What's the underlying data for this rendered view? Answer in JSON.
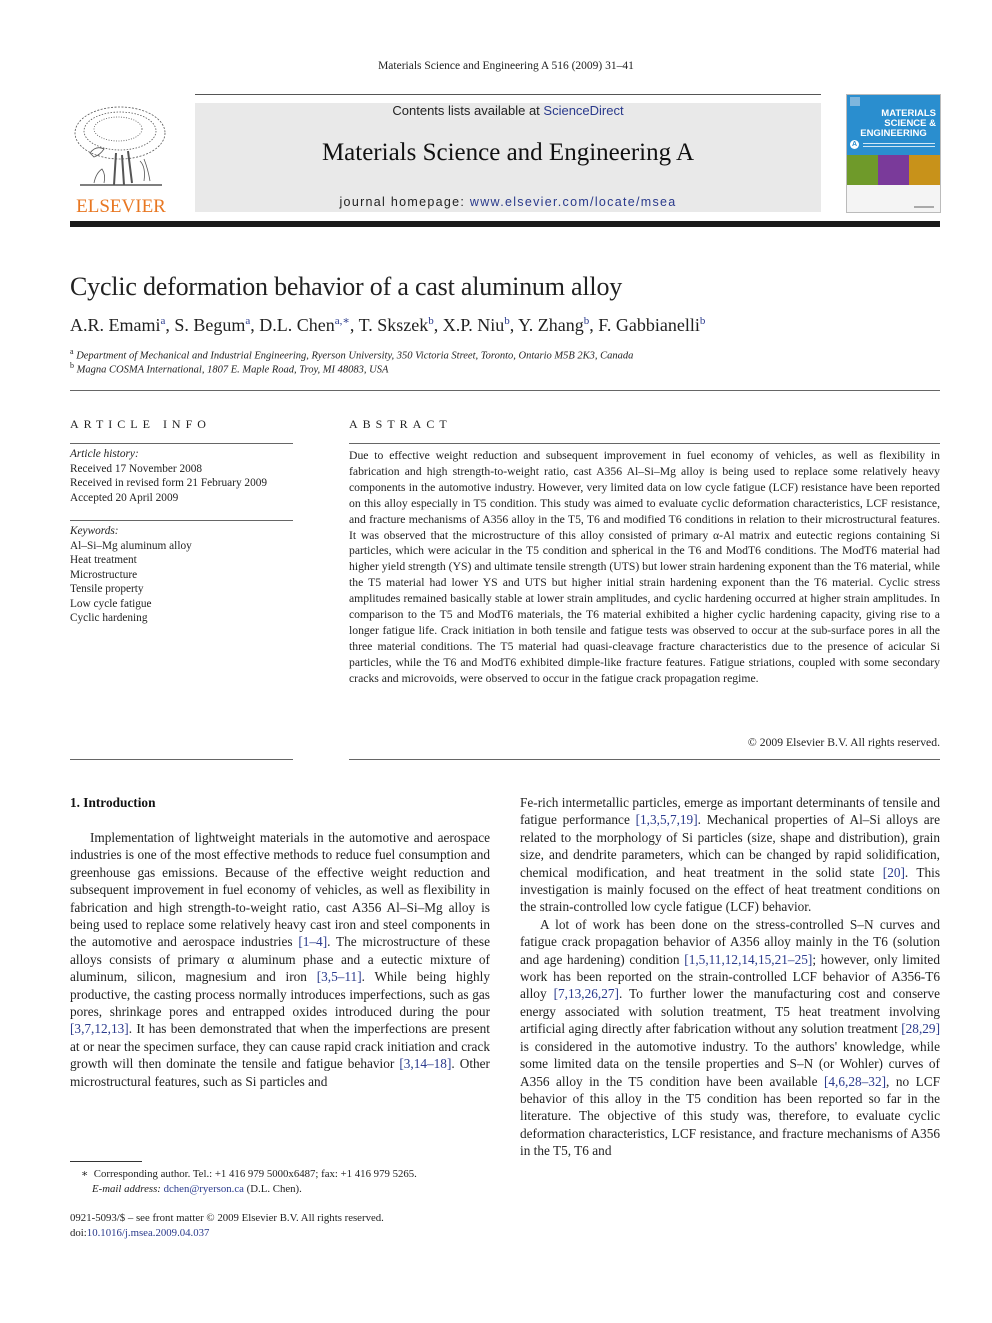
{
  "running_head": "Materials Science and Engineering A 516 (2009) 31–41",
  "masthead": {
    "contents_prefix": "Contents lists available at ",
    "contents_link": "ScienceDirect",
    "journal_title": "Materials Science and Engineering A",
    "homepage_prefix": "journal homepage: ",
    "homepage_link": "www.elsevier.com/locate/msea",
    "publisher_wordmark": "ELSEVIER",
    "cover": {
      "line1": "MATERIALS",
      "line2": "SCIENCE &",
      "line3": "ENGINEERING",
      "badge": "A",
      "color_bg": "#2a8ecf",
      "image_colors": [
        "#6f9a2a",
        "#7a3a9a",
        "#c8921a"
      ]
    }
  },
  "article": {
    "title": "Cyclic deformation behavior of a cast aluminum alloy",
    "authors": [
      {
        "name": "A.R. Emami",
        "aff": "a"
      },
      {
        "name": "S. Begum",
        "aff": "a"
      },
      {
        "name": "D.L. Chen",
        "aff": "a,∗"
      },
      {
        "name": "T. Skszek",
        "aff": "b"
      },
      {
        "name": "X.P. Niu",
        "aff": "b"
      },
      {
        "name": "Y. Zhang",
        "aff": "b"
      },
      {
        "name": "F. Gabbianelli",
        "aff": "b"
      }
    ],
    "affiliations": [
      {
        "mark": "a",
        "text": "Department of Mechanical and Industrial Engineering, Ryerson University, 350 Victoria Street, Toronto, Ontario M5B 2K3, Canada"
      },
      {
        "mark": "b",
        "text": "Magna COSMA International, 1807 E. Maple Road, Troy, MI 48083, USA"
      }
    ]
  },
  "article_info": {
    "heading": "ARTICLE INFO",
    "history_label": "Article history:",
    "history": [
      "Received 17 November 2008",
      "Received in revised form 21 February 2009",
      "Accepted 20 April 2009"
    ],
    "keywords_label": "Keywords:",
    "keywords": [
      "Al–Si–Mg aluminum alloy",
      "Heat treatment",
      "Microstructure",
      "Tensile property",
      "Low cycle fatigue",
      "Cyclic hardening"
    ]
  },
  "abstract": {
    "heading": "ABSTRACT",
    "text": "Due to effective weight reduction and subsequent improvement in fuel economy of vehicles, as well as flexibility in fabrication and high strength-to-weight ratio, cast A356 Al–Si–Mg alloy is being used to replace some relatively heavy components in the automotive industry. However, very limited data on low cycle fatigue (LCF) resistance have been reported on this alloy especially in T5 condition. This study was aimed to evaluate cyclic deformation characteristics, LCF resistance, and fracture mechanisms of A356 alloy in the T5, T6 and modified T6 conditions in relation to their microstructural features. It was observed that the microstructure of this alloy consisted of primary α-Al matrix and eutectic regions containing Si particles, which were acicular in the T5 condition and spherical in the T6 and ModT6 conditions. The ModT6 material had higher yield strength (YS) and ultimate tensile strength (UTS) but lower strain hardening exponent than the T6 material, while the T5 material had lower YS and UTS but higher initial strain hardening exponent than the T6 material. Cyclic stress amplitudes remained basically stable at lower strain amplitudes, and cyclic hardening occurred at higher strain amplitudes. In comparison to the T5 and ModT6 materials, the T6 material exhibited a higher cyclic hardening capacity, giving rise to a longer fatigue life. Crack initiation in both tensile and fatigue tests was observed to occur at the sub-surface pores in all the three material conditions. The T5 material had quasi-cleavage fracture characteristics due to the presence of acicular Si particles, while the T6 and ModT6 exhibited dimple-like fracture features. Fatigue striations, coupled with some secondary cracks and microvoids, were observed to occur in the fatigue crack propagation regime.",
    "copyright": "© 2009 Elsevier B.V. All rights reserved."
  },
  "introduction": {
    "heading": "1.  Introduction",
    "left_column": [
      {
        "t": "Implementation of lightweight materials in the automotive and aerospace industries is one of the most effective methods to reduce fuel consumption and greenhouse gas emissions. Because of the effective weight reduction and subsequent improvement in fuel economy of vehicles, as well as flexibility in fabrication and high strength-to-weight ratio, cast A356 Al–Si–Mg alloy is being used to replace some relatively heavy cast iron and steel components in the automotive and aerospace industries "
      },
      {
        "ref": "[1–4]"
      },
      {
        "t": ". The microstructure of these alloys consists of primary α aluminum phase and a eutectic mixture of aluminum, silicon, magnesium and iron "
      },
      {
        "ref": "[3,5–11]"
      },
      {
        "t": ". While being highly productive, the casting process normally introduces imperfections, such as gas pores, shrinkage pores and entrapped oxides introduced during the pour "
      },
      {
        "ref": "[3,7,12,13]"
      },
      {
        "t": ". It has been demonstrated that when the imperfections are present at or near the specimen surface, they can cause rapid crack initiation and crack growth will then dominate the tensile and fatigue behavior "
      },
      {
        "ref": "[3,14–18]"
      },
      {
        "t": ". Other microstructural features, such as Si particles and"
      }
    ],
    "right_column_p1": [
      {
        "t": "Fe-rich intermetallic particles, emerge as important determinants of tensile and fatigue performance "
      },
      {
        "ref": "[1,3,5,7,19]"
      },
      {
        "t": ". Mechanical properties of Al–Si alloys are related to the morphology of Si particles (size, shape and distribution), grain size, and dendrite parameters, which can be changed by rapid solidification, chemical modification, and heat treatment in the solid state "
      },
      {
        "ref": "[20]"
      },
      {
        "t": ". This investigation is mainly focused on the effect of heat treatment conditions on the strain-controlled low cycle fatigue (LCF) behavior."
      }
    ],
    "right_column_p2": [
      {
        "t": "A lot of work has been done on the stress-controlled S–N curves and fatigue crack propagation behavior of A356 alloy mainly in the T6 (solution and age hardening) condition "
      },
      {
        "ref": "[1,5,11,12,14,15,21–25]"
      },
      {
        "t": "; however, only limited work has been reported on the strain-controlled LCF behavior of A356-T6 alloy "
      },
      {
        "ref": "[7,13,26,27]"
      },
      {
        "t": ". To further lower the manufacturing cost and conserve energy associated with solution treatment, T5 heat treatment involving artificial aging directly after fabrication without any solution treatment "
      },
      {
        "ref": "[28,29]"
      },
      {
        "t": " is considered in the automotive industry. To the authors' knowledge, while some limited data on the tensile properties and S–N (or Wohler) curves of A356 alloy in the T5 condition have been available "
      },
      {
        "ref": "[4,6,28–32]"
      },
      {
        "t": ", no LCF behavior of this alloy in the T5 condition has been reported so far in the literature. The objective of this study was, therefore, to evaluate cyclic deformation characteristics, LCF resistance, and fracture mechanisms of A356 in the T5, T6 and"
      }
    ]
  },
  "footnotes": {
    "corresponding_mark": "∗",
    "corresponding_text": "Corresponding author. Tel.: +1 416 979 5000x6487; fax: +1 416 979 5265.",
    "email_label": "E-mail address: ",
    "email": "dchen@ryerson.ca",
    "email_suffix": " (D.L. Chen).",
    "front_matter": "0921-5093/$ – see front matter © 2009 Elsevier B.V. All rights reserved.",
    "doi_label": "doi:",
    "doi": "10.1016/j.msea.2009.04.037"
  },
  "colors": {
    "link": "#2a3a8c",
    "elsevier_orange": "#e87722",
    "masthead_bg": "#e9e9e9"
  }
}
